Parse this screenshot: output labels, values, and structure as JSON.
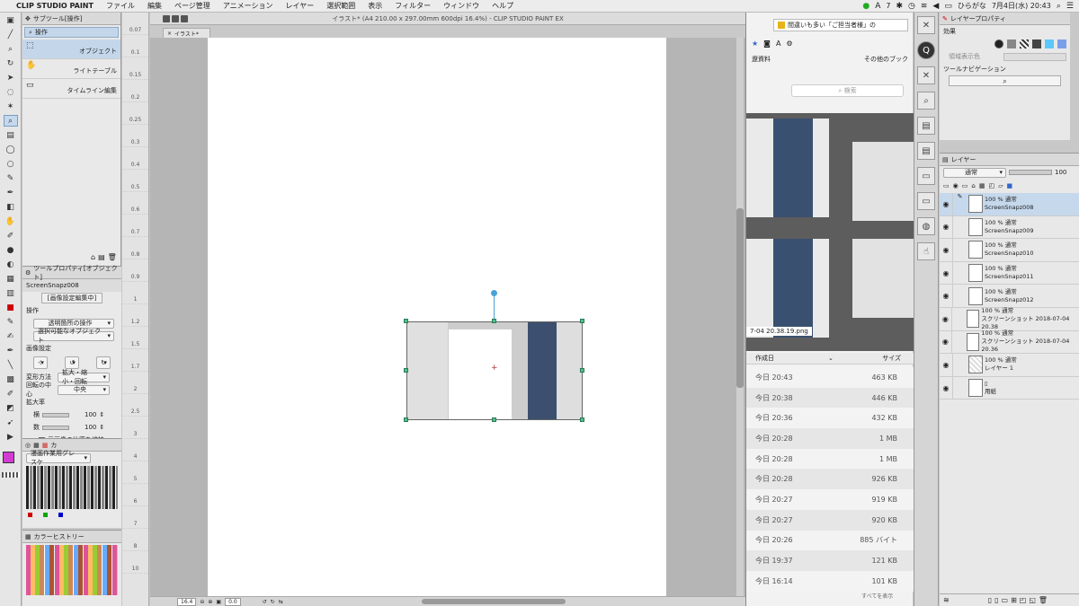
{
  "menubar": {
    "apple": "",
    "app_name": "CLIP STUDIO PAINT",
    "menus": [
      "ファイル",
      "編集",
      "ページ管理",
      "アニメーション",
      "レイヤー",
      "選択範囲",
      "表示",
      "フィルター",
      "ウィンドウ",
      "ヘルプ"
    ],
    "status": {
      "badge": "7",
      "ime": "ひらがな",
      "datetime": "7月4日(水) 20:43"
    }
  },
  "subtool": {
    "tab_label": "サブツール[操作]",
    "category": "操作",
    "items": [
      "オブジェクト",
      "ライトテーブル",
      "タイムライン編集"
    ]
  },
  "toolprop": {
    "tab_label": "ツールプロパティ[オブジェクト]",
    "layer_name": "ScreenSnapz008",
    "mode_label": "[画像設定編集中]",
    "section_op": "操作",
    "op_select": "透明箇所の操作",
    "op_select2": "選択可能なオブジェクト",
    "section_img": "画像設定",
    "transform_label": "変形方法",
    "transform_value": "拡大・縮小・回転",
    "center_label": "回転の中心",
    "center_value": "中央",
    "scale_label": "拡大率",
    "w_label": "横",
    "w_value": "100",
    "h_label": "数",
    "h_value": "100",
    "keep_ratio": "元画像の比率を維持"
  },
  "colorset": {
    "tab_label": "カ",
    "set_name": "漫画作業用グレスケ"
  },
  "history": {
    "tab_label": "カラーヒストリー"
  },
  "ruler": {
    "ticks": [
      "0.07",
      "0.1",
      "0.15",
      "0.2",
      "0.25",
      "0.3",
      "0.4",
      "0.5",
      "0.6",
      "0.7",
      "0.8",
      "0.9",
      "1",
      "1.2",
      "1.5",
      "1.7",
      "2",
      "2.5",
      "3",
      "4",
      "5",
      "6",
      "7",
      "8",
      "10"
    ]
  },
  "canvas": {
    "title": "イラスト* (A4 210.00 x 297.00mm 600dpi 16.4%)  - CLIP STUDIO PAINT EX",
    "tab": "イラスト*",
    "zoom": "16.4",
    "angle": "0.0"
  },
  "browser": {
    "tab_title": "間違いも多い「ご担当者様」の",
    "bookmark": "遼資料",
    "other_bookmarks": "その他のブック",
    "search_placeholder": "検索",
    "preview_caption": "7-04 20.38.19.png",
    "col_date": "作成日",
    "col_size": "サイズ",
    "files": [
      {
        "date": "今日 20:43",
        "size": "463 KB"
      },
      {
        "date": "今日 20:38",
        "size": "446 KB"
      },
      {
        "date": "今日 20:36",
        "size": "432 KB"
      },
      {
        "date": "今日 20:28",
        "size": "1 MB"
      },
      {
        "date": "今日 20:28",
        "size": "1 MB"
      },
      {
        "date": "今日 20:28",
        "size": "926 KB"
      },
      {
        "date": "今日 20:27",
        "size": "919 KB"
      },
      {
        "date": "今日 20:27",
        "size": "920 KB"
      },
      {
        "date": "今日 20:26",
        "size": "885 バイト"
      },
      {
        "date": "今日 19:37",
        "size": "121 KB"
      },
      {
        "date": "今日 16:14",
        "size": "101 KB"
      }
    ],
    "footer": "すべてを表示"
  },
  "props": {
    "tab_label": "レイヤープロパティ",
    "effect_label": "効果",
    "area_label": "領域表示色",
    "nav_label": "ツールナビゲーション"
  },
  "layers": {
    "tab_label": "レイヤー",
    "blend": "通常",
    "opacity": "100",
    "items": [
      {
        "mode": "100 % 通常",
        "name": "ScreenSnapz008",
        "selected": true
      },
      {
        "mode": "100 % 通常",
        "name": "ScreenSnapz009",
        "selected": false
      },
      {
        "mode": "100 % 通常",
        "name": "ScreenSnapz010",
        "selected": false
      },
      {
        "mode": "100 % 通常",
        "name": "ScreenSnapz011",
        "selected": false
      },
      {
        "mode": "100 % 通常",
        "name": "ScreenSnapz012",
        "selected": false
      },
      {
        "mode": "100 % 通常",
        "name": "スクリーンショット 2018-07-04 20.38",
        "selected": false
      },
      {
        "mode": "100 % 通常",
        "name": "スクリーンショット 2018-07-04 20.36",
        "selected": false
      },
      {
        "mode": "100 % 通常",
        "name": "レイヤー 1",
        "selected": false
      },
      {
        "mode": "",
        "name": "用紙",
        "selected": false
      }
    ]
  },
  "colors": {
    "main": "#d33bd3",
    "selection": "#c5d8ec",
    "handle": "#4fc08d"
  }
}
